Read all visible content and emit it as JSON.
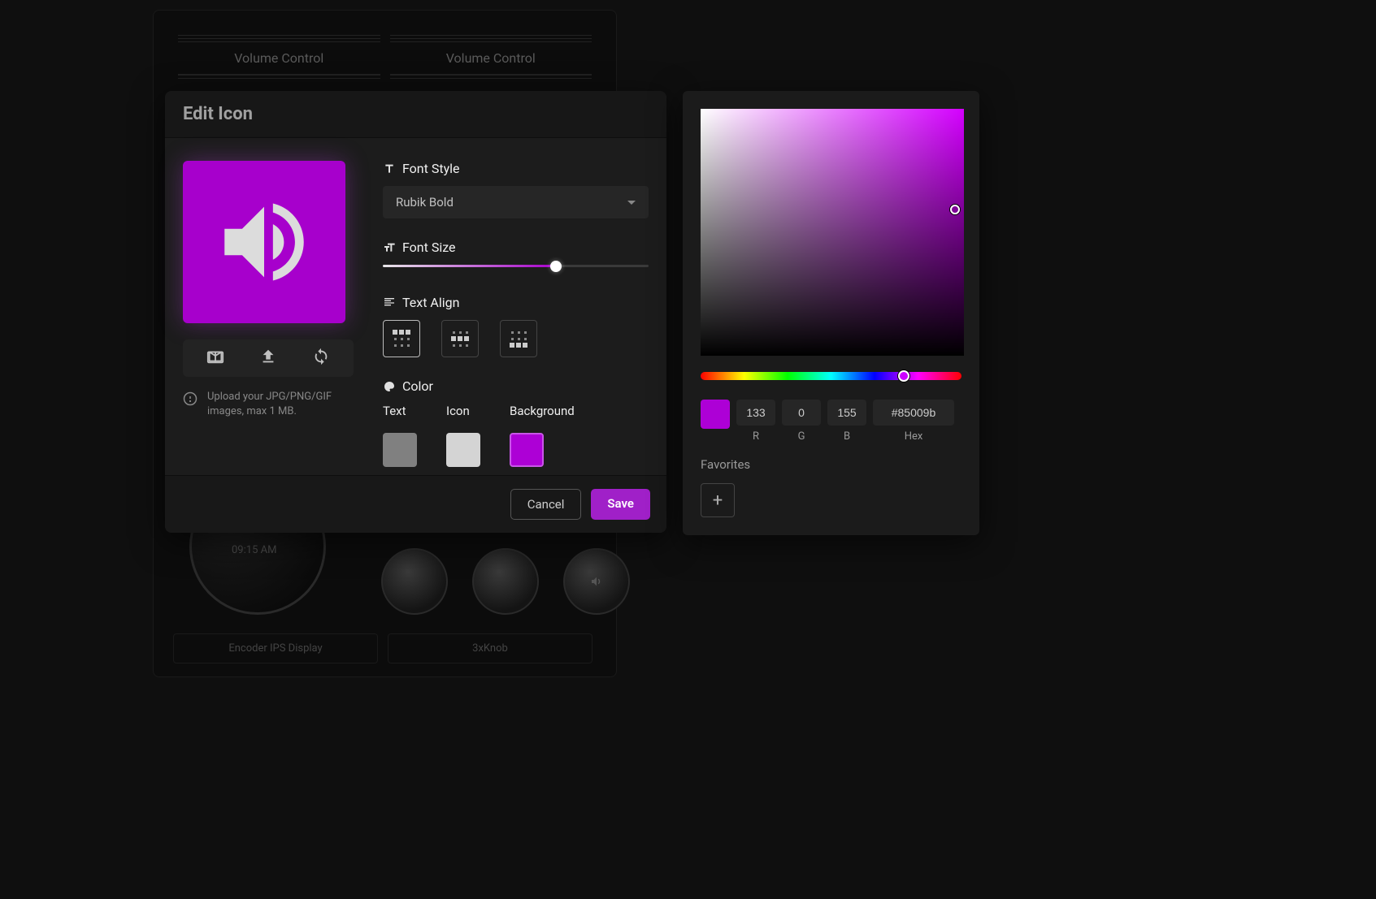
{
  "background": {
    "card1_title": "Volume Control",
    "card2_title": "Volume Control",
    "encoder_time": "09:15 AM",
    "caption1": "Encoder IPS Display",
    "caption2": "3xKnob"
  },
  "dialog": {
    "title": "Edit Icon",
    "font_style": {
      "label": "Font Style",
      "value": "Rubik Bold"
    },
    "font_size": {
      "label": "Font Size",
      "percent": 65
    },
    "text_align": {
      "label": "Text Align",
      "selected": 0
    },
    "color": {
      "label": "Color",
      "text_label": "Text",
      "icon_label": "Icon",
      "background_label": "Background",
      "text_color": "#808080",
      "icon_color": "#d4d4d4",
      "background_color": "#ad00d6"
    },
    "upload_hint": "Upload your JPG/PNG/GIF images, max 1 MB.",
    "cancel_label": "Cancel",
    "save_label": "Save"
  },
  "picker": {
    "r": "133",
    "g": "0",
    "b": "155",
    "hex": "#85009b",
    "r_label": "R",
    "g_label": "G",
    "b_label": "B",
    "hex_label": "Hex",
    "favorites_label": "Favorites"
  }
}
